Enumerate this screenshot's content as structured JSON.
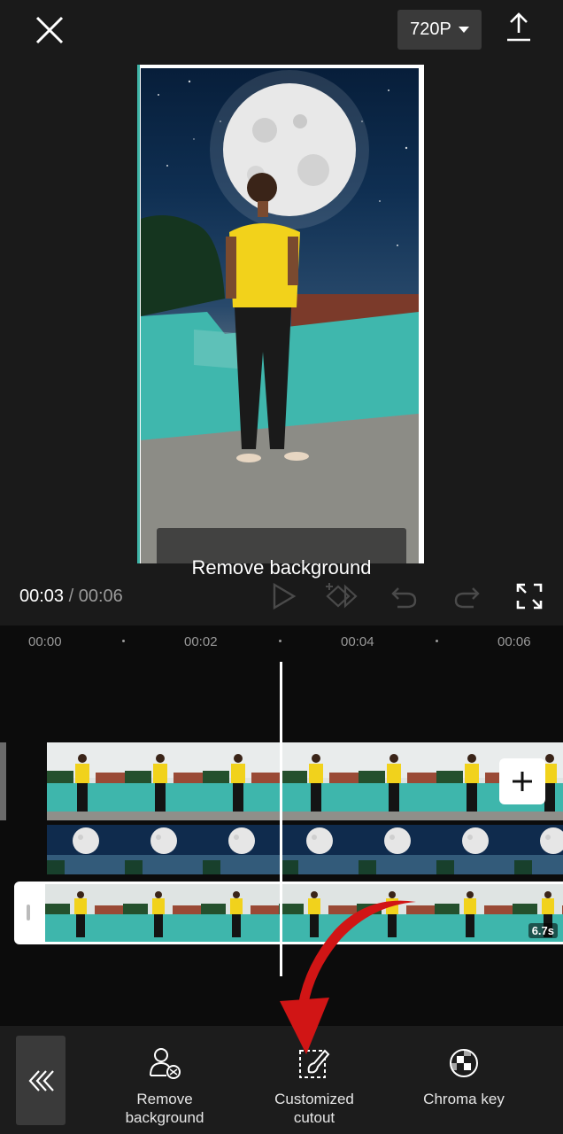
{
  "top_bar": {
    "close_icon": "close-icon",
    "resolution": "720P",
    "export_icon": "export-upload-icon"
  },
  "preview": {
    "toast_text": "Remove background"
  },
  "playback": {
    "current_time": "00:03",
    "separator": " / ",
    "duration": "00:06"
  },
  "timeline": {
    "ruler": [
      "00:00",
      "00:02",
      "00:04",
      "00:06"
    ],
    "selected_clip_duration": "6.7s"
  },
  "toolbar": {
    "items": [
      {
        "label_line1": "Remove",
        "label_line2": "background",
        "icon": "person-remove-icon"
      },
      {
        "label_line1": "Customized",
        "label_line2": "cutout",
        "icon": "brush-cutout-icon"
      },
      {
        "label_line1": "Chroma key",
        "label_line2": "",
        "icon": "chroma-key-icon"
      }
    ]
  },
  "colors": {
    "background": "#1a1a1a",
    "timeline_bg": "#0c0c0c",
    "annotation_arrow": "#d11515",
    "frame_accent": "#3fb5a8"
  }
}
